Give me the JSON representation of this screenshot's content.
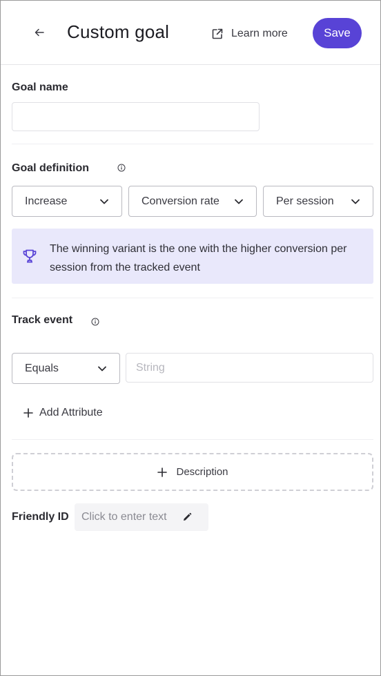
{
  "header": {
    "title": "Custom goal",
    "learn_more": "Learn more",
    "save": "Save"
  },
  "goal_name": {
    "label": "Goal name",
    "value": "",
    "placeholder": ""
  },
  "goal_definition": {
    "label": "Goal definition",
    "direction": "Increase",
    "metric": "Conversion rate",
    "scope": "Per session",
    "info_text": "The winning variant is the one with the higher conversion per session from the tracked event"
  },
  "track_event": {
    "label": "Track event",
    "operator": "Equals",
    "value_placeholder": "String",
    "add_attribute": "Add Attribute"
  },
  "description": {
    "label": "Description"
  },
  "friendly_id": {
    "label": "Friendly ID",
    "placeholder": "Click to enter text"
  },
  "colors": {
    "accent": "#5843d6",
    "info_bg": "#e9e8fb"
  },
  "icons": {
    "back": "arrow-left-icon",
    "external": "external-link-icon",
    "info": "info-icon",
    "chevron": "chevron-down-icon",
    "trophy": "trophy-icon",
    "plus": "plus-icon",
    "pencil": "pencil-icon"
  }
}
